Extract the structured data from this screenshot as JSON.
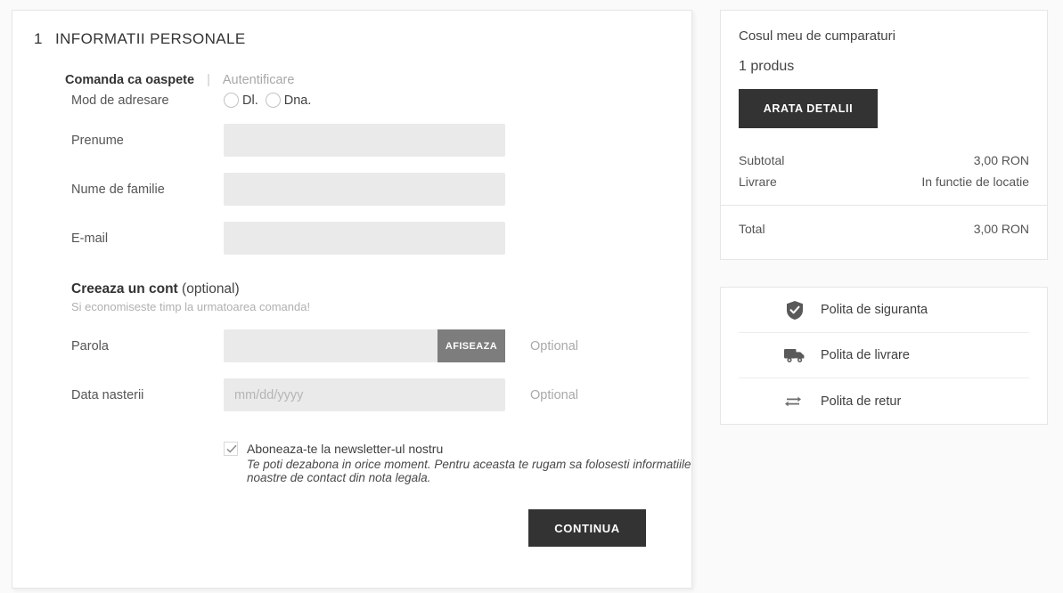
{
  "checkout": {
    "step_number": "1",
    "step_title": "INFORMATII PERSONALE",
    "tabs": {
      "guest": "Comanda ca oaspete",
      "separator": "|",
      "login": "Autentificare"
    },
    "salutation": {
      "label": "Mod de adresare",
      "options": [
        "Dl.",
        "Dna."
      ],
      "selected": ""
    },
    "fields": [
      {
        "label": "Prenume",
        "value": "",
        "placeholder": ""
      },
      {
        "label": "Nume de familie",
        "value": "",
        "placeholder": ""
      },
      {
        "label": "E-mail",
        "value": "",
        "placeholder": ""
      }
    ],
    "account": {
      "heading_bold": "Creeaza un cont",
      "heading_rest": " (optional)",
      "subtitle": "Si economiseste timp la urmatoarea comanda!",
      "password": {
        "label": "Parola",
        "value": "",
        "placeholder": "",
        "toggle_label": "AFISEAZA",
        "optional_note": "Optional"
      },
      "birthdate": {
        "label": "Data nasterii",
        "value": "",
        "placeholder": "mm/dd/yyyy",
        "optional_note": "Optional"
      }
    },
    "newsletter": {
      "checked": true,
      "label": "Aboneaza-te la newsletter-ul nostru",
      "note": "Te poti dezabona in orice moment. Pentru aceasta te rugam sa folosesti informatiile noastre de contact din nota legala."
    },
    "continue_label": "CONTINUA"
  },
  "cart": {
    "title": "Cosul meu de cumparaturi",
    "count": "1 produs",
    "details_button": "ARATA DETALII",
    "summary": [
      {
        "label": "Subtotal",
        "value": "3,00 RON"
      },
      {
        "label": "Livrare",
        "value": "In functie de locatie"
      }
    ],
    "total": {
      "label": "Total",
      "value": "3,00 RON"
    }
  },
  "policies": [
    {
      "icon": "shield-check-icon",
      "label": "Polita de siguranta"
    },
    {
      "icon": "truck-icon",
      "label": "Polita de livrare"
    },
    {
      "icon": "exchange-arrows-icon",
      "label": "Polita de retur"
    }
  ],
  "colors": {
    "page_background": "#fafafa",
    "panel_background": "#ffffff",
    "field_background": "#eaeaea",
    "button_dark": "#333333",
    "toggle_gray": "#7d7d7d",
    "border": "#e6e6e6",
    "muted_text": "#a8a8a8"
  }
}
